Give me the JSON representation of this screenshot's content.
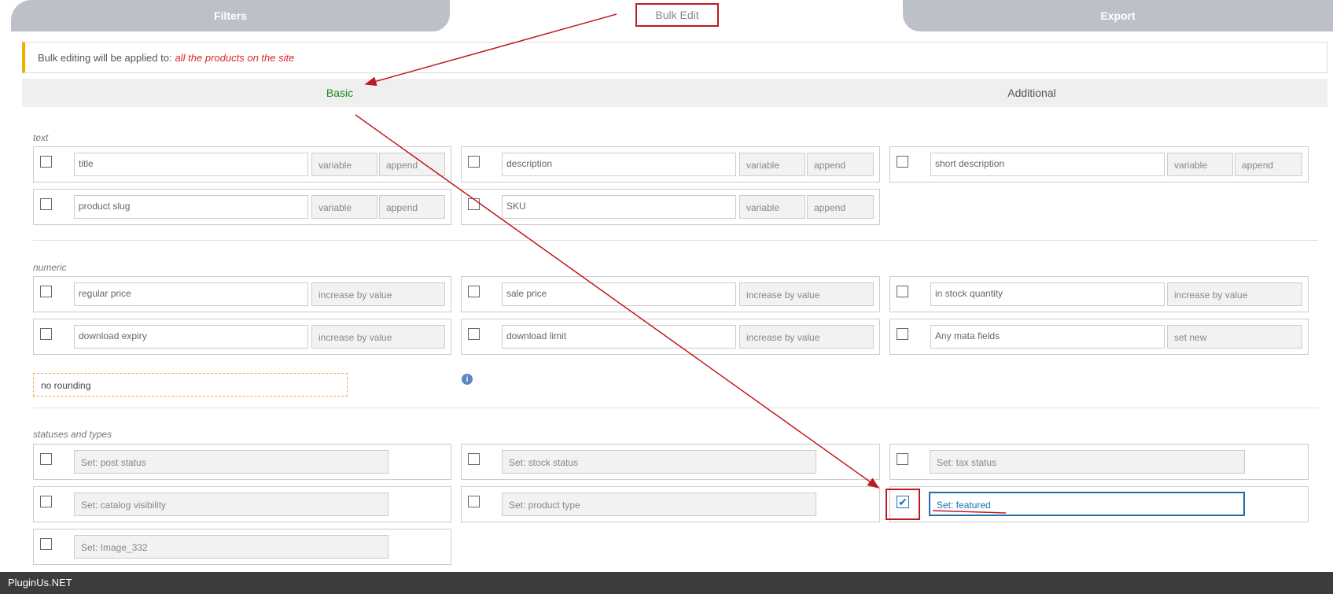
{
  "tabs": {
    "filters": "Filters",
    "bulk_edit": "Bulk Edit",
    "export": "Export"
  },
  "notice": {
    "prefix": "Bulk editing will be applied to:",
    "target": "all the products on the site"
  },
  "subtabs": {
    "basic": "Basic",
    "additional": "Additional"
  },
  "sections": {
    "text": "text",
    "numeric": "numeric",
    "statuses": "statuses and types"
  },
  "text_fields": {
    "title": {
      "placeholder": "title",
      "mode": "variable",
      "action": "append"
    },
    "description": {
      "placeholder": "description",
      "mode": "variable",
      "action": "append"
    },
    "short_description": {
      "placeholder": "short description",
      "mode": "variable",
      "action": "append"
    },
    "product_slug": {
      "placeholder": "product slug",
      "mode": "variable",
      "action": "append"
    },
    "sku": {
      "placeholder": "SKU",
      "mode": "variable",
      "action": "append"
    }
  },
  "numeric_fields": {
    "regular_price": {
      "placeholder": "regular price",
      "action": "increase by value"
    },
    "sale_price": {
      "placeholder": "sale price",
      "action": "increase by value"
    },
    "in_stock_quantity": {
      "placeholder": "in stock quantity",
      "action": "increase by value"
    },
    "download_expiry": {
      "placeholder": "download expiry",
      "action": "increase by value"
    },
    "download_limit": {
      "placeholder": "download limit",
      "action": "increase by value"
    },
    "meta_fields": {
      "placeholder": "Any mata fields",
      "action": "set new"
    }
  },
  "rounding": "no rounding",
  "info_icon": "i",
  "status_fields": {
    "post_status": "Set: post status",
    "stock_status": "Set: stock status",
    "tax_status": "Set: tax status",
    "catalog_visibility": "Set: catalog visibility",
    "product_type": "Set: product type",
    "featured": "Set: featured",
    "image": "Set: Image_332"
  },
  "featured_checked": true,
  "checkmark": "✔",
  "footer": "PluginUs.NET",
  "colors": {
    "accent_red": "#c0191f",
    "active_green": "#1a8a1a",
    "focus_blue": "#1e6fb0",
    "notice_yellow": "#f0b000"
  }
}
